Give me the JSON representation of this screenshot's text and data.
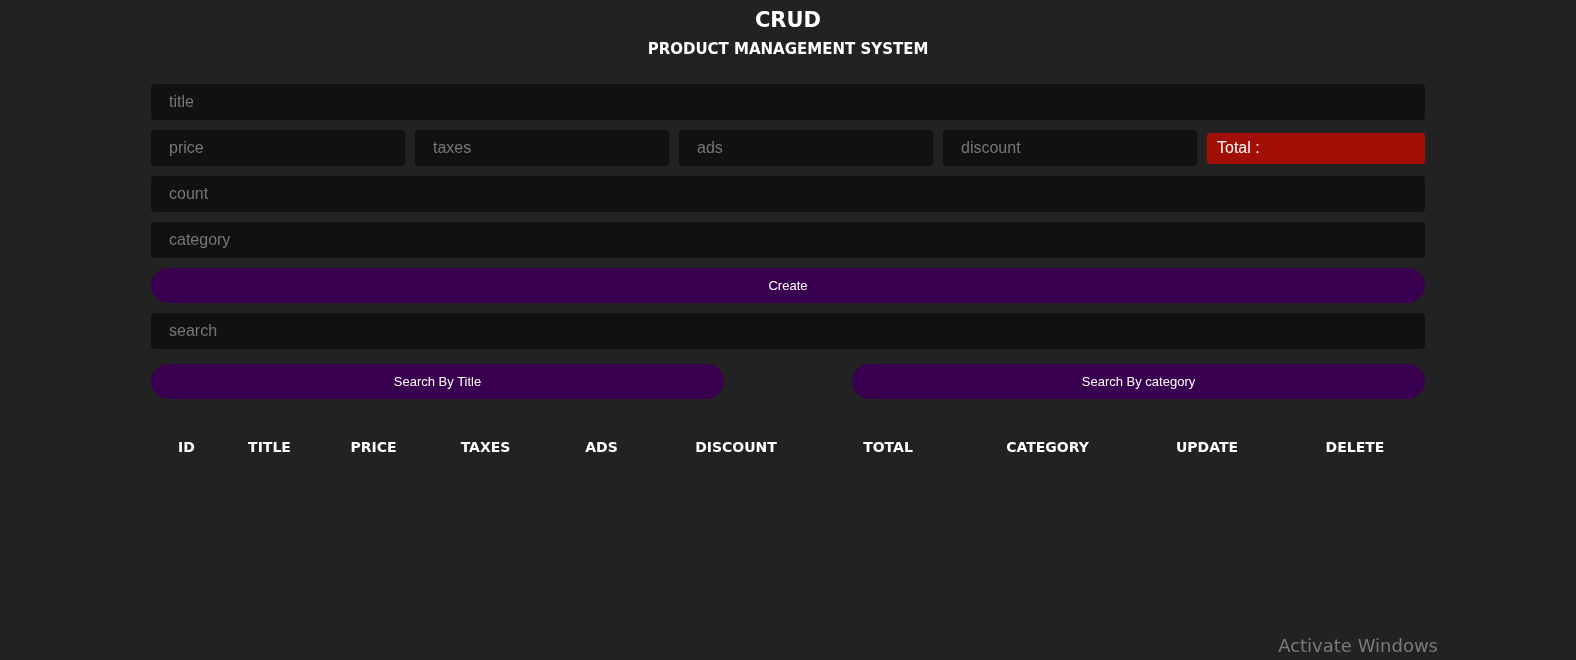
{
  "header": {
    "title": "CRUD",
    "subtitle": "PRODUCT MANAGEMENT SYSTEM"
  },
  "form": {
    "title_field": {
      "placeholder": "title"
    },
    "price_fields": [
      {
        "placeholder": "price"
      },
      {
        "placeholder": "taxes"
      },
      {
        "placeholder": "ads"
      },
      {
        "placeholder": "discount"
      }
    ],
    "total": {
      "label": "Total :"
    },
    "count_field": {
      "placeholder": "count"
    },
    "category_field": {
      "placeholder": "category"
    },
    "create_button": "Create"
  },
  "search": {
    "placeholder": "search",
    "buttons": [
      "Search By Title",
      "Search By category"
    ]
  },
  "table": {
    "columns": [
      "ID",
      "TITLE",
      "PRICE",
      "TAXES",
      "ADS",
      "DISCOUNT",
      "TOTAL",
      "CATEGORY",
      "UPDATE",
      "DELETE"
    ]
  },
  "os_overlay": {
    "text": "Activate Windows"
  }
}
